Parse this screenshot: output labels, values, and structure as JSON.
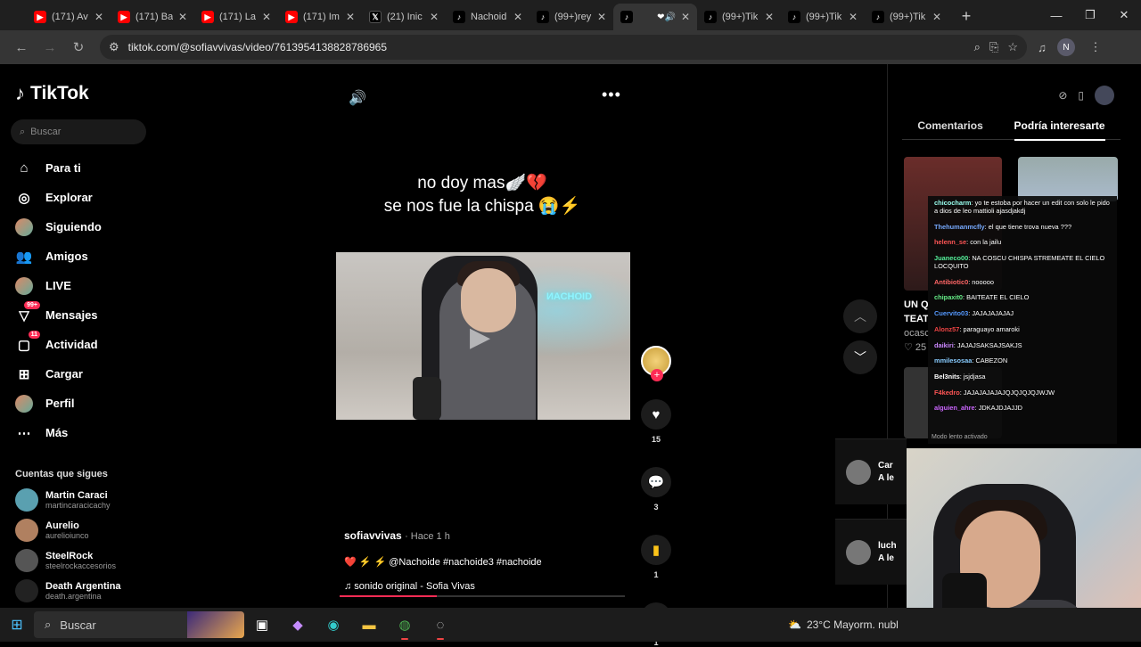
{
  "browser": {
    "tabs": [
      {
        "icon": "youtube-icon",
        "title": "(171) Av",
        "active": false,
        "kind": "yt"
      },
      {
        "icon": "youtube-icon",
        "title": "(171) Ba",
        "active": false,
        "kind": "yt"
      },
      {
        "icon": "youtube-icon",
        "title": "(171) La",
        "active": false,
        "kind": "yt"
      },
      {
        "icon": "youtube-icon",
        "title": "(171) Im",
        "active": false,
        "kind": "yt"
      },
      {
        "icon": "x-icon",
        "title": "(21) Inic",
        "active": false,
        "kind": "x"
      },
      {
        "icon": "tiktok-icon",
        "title": "Nachoid",
        "active": false,
        "kind": "tt"
      },
      {
        "icon": "tiktok-icon",
        "title": "(99+)rey",
        "active": false,
        "kind": "tt"
      },
      {
        "icon": "tiktok-icon",
        "title": "",
        "active": true,
        "kind": "tt"
      },
      {
        "icon": "tiktok-icon",
        "title": "(99+)Tik",
        "active": false,
        "kind": "tt"
      },
      {
        "icon": "tiktok-icon",
        "title": "(99+)Tik",
        "active": false,
        "kind": "tt"
      },
      {
        "icon": "tiktok-icon",
        "title": "(99+)Tik",
        "active": false,
        "kind": "tt"
      }
    ],
    "url": "tiktok.com/@sofiavvivas/video/7613954138828786965",
    "profile_initial": "N"
  },
  "sidebar": {
    "brand": "TikTok",
    "search_placeholder": "Buscar",
    "nav": [
      {
        "label": "Para ti",
        "icon": "home-icon",
        "glyph": "⌂"
      },
      {
        "label": "Explorar",
        "icon": "compass-icon",
        "glyph": "◎"
      },
      {
        "label": "Siguiendo",
        "icon": "following-avatar-icon",
        "glyph": ""
      },
      {
        "label": "Amigos",
        "icon": "friends-icon",
        "glyph": "👥"
      },
      {
        "label": "LIVE",
        "icon": "live-avatar-icon",
        "glyph": ""
      },
      {
        "label": "Mensajes",
        "icon": "messages-icon",
        "glyph": "▽",
        "badge": "99+"
      },
      {
        "label": "Actividad",
        "icon": "activity-icon",
        "glyph": "▢",
        "badge": "11"
      },
      {
        "label": "Cargar",
        "icon": "upload-icon",
        "glyph": "⊞"
      },
      {
        "label": "Perfil",
        "icon": "profile-avatar-icon",
        "glyph": ""
      },
      {
        "label": "Más",
        "icon": "more-icon",
        "glyph": "⋯"
      }
    ],
    "following_heading": "Cuentas que sigues",
    "following": [
      {
        "name": "Martin Caraci",
        "handle": "martincaracicachy",
        "color": "#5aa0b0"
      },
      {
        "name": "Aurelio",
        "handle": "aurelioiunco",
        "color": "#b08060"
      },
      {
        "name": "SteelRock",
        "handle": "steelrockaccesorios",
        "color": "#555555"
      },
      {
        "name": "Death Argentina",
        "handle": "death.argentina",
        "color": "#222222"
      }
    ]
  },
  "video": {
    "caption_line1": "no doy mas🪽💔",
    "caption_line2": "se nos fue la chispa 😭⚡",
    "neon_sign": "ИАСHOID",
    "likes": "15",
    "comments": "3",
    "saves": "1",
    "shares": "1",
    "author": "sofiavvivas",
    "posted": "· Hace 1 h",
    "description": "❤️ ⚡ ⚡ @Nachoide #nachoide3 #nachoide",
    "sound": "♫  sonido original - Sofia Vivas",
    "progress": 0.34
  },
  "right_panel": {
    "tab_comments": "Comentarios",
    "tab_suggested": "Podría interesarte",
    "suggested_title_1": "UN Q",
    "suggested_title_2": "TEAT",
    "suggested_user": "ocasc",
    "suggested_likes": "♡ 25",
    "comment1_name": "Car",
    "comment1_text": "A le",
    "comment2_name": "luch",
    "comment2_text": "A le"
  },
  "chat": {
    "messages": [
      {
        "user": "chicocharm",
        "text": "yo te estoba por hacer un edit con solo le pido a dios de leo mattioli ajasdjakdj",
        "color": "#9fe"
      },
      {
        "user": "Thehumanmcfly",
        "text": "el que tiene trova nueva ???",
        "color": "#7af"
      },
      {
        "user": "helenn_se",
        "text": "con la jailu",
        "color": "#f55"
      },
      {
        "user": "Juaneco00",
        "text": "NA COSCU CHISPA STREMEATE EL CIELO LOCQUITO",
        "color": "#5e9"
      },
      {
        "user": "Antibiotic0",
        "text": "nooooo",
        "color": "#f66"
      },
      {
        "user": "chipaxit0",
        "text": "BAITEATE EL CIELO",
        "color": "#6e8"
      },
      {
        "user": "Cuervito03",
        "text": "JAJAJAJAJAJ",
        "color": "#59f"
      },
      {
        "user": "Alonz57",
        "text": "paraguayo amaroki",
        "color": "#e44"
      },
      {
        "user": "daikiri",
        "text": "JAJAJSAKSAJSAKJS",
        "color": "#c8f"
      },
      {
        "user": "mmilesosaa",
        "text": "CABEZON",
        "color": "#8cf"
      },
      {
        "user": "Bel3nits",
        "text": "jsjdjasa",
        "color": "#fff"
      },
      {
        "user": "F4kedro",
        "text": "JAJAJAJAJAJQJQJQJQJWJW",
        "color": "#f55"
      },
      {
        "user": "alguien_ahre",
        "text": "JDKAJDJAJJD",
        "color": "#c6f"
      }
    ],
    "footer": "Modo lento activado"
  },
  "taskbar": {
    "search_placeholder": "Buscar",
    "weather": "23°C  Mayorm. nubl"
  }
}
